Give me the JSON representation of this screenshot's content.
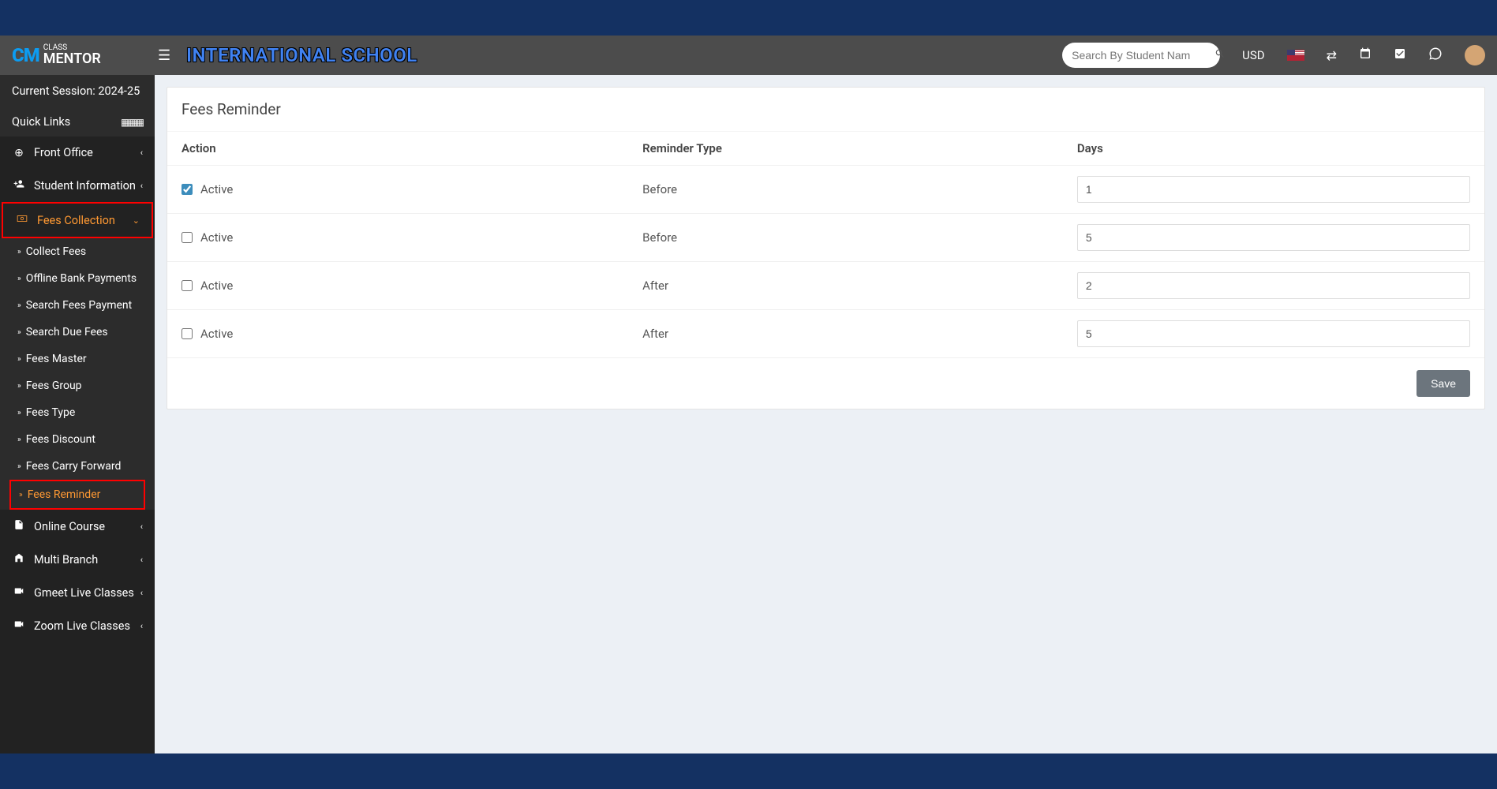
{
  "header": {
    "school_name": "INTERNATIONAL SCHOOL",
    "search_placeholder": "Search By Student Nam",
    "currency": "USD"
  },
  "sidebar": {
    "session_label": "Current Session: 2024-25",
    "quick_links_label": "Quick Links",
    "menu": [
      {
        "label": "Front Office"
      },
      {
        "label": "Student Information"
      },
      {
        "label": "Fees Collection"
      },
      {
        "label": "Online Course"
      },
      {
        "label": "Multi Branch"
      },
      {
        "label": "Gmeet Live Classes"
      },
      {
        "label": "Zoom Live Classes"
      }
    ],
    "fees_submenu": [
      {
        "label": "Collect Fees"
      },
      {
        "label": "Offline Bank Payments"
      },
      {
        "label": "Search Fees Payment"
      },
      {
        "label": "Search Due Fees"
      },
      {
        "label": "Fees Master"
      },
      {
        "label": "Fees Group"
      },
      {
        "label": "Fees Type"
      },
      {
        "label": "Fees Discount"
      },
      {
        "label": "Fees Carry Forward"
      },
      {
        "label": "Fees Reminder"
      }
    ]
  },
  "main": {
    "title": "Fees Reminder",
    "columns": {
      "action": "Action",
      "type": "Reminder Type",
      "days": "Days"
    },
    "active_label": "Active",
    "rows": [
      {
        "checked": true,
        "type": "Before",
        "days": "1"
      },
      {
        "checked": false,
        "type": "Before",
        "days": "5"
      },
      {
        "checked": false,
        "type": "After",
        "days": "2"
      },
      {
        "checked": false,
        "type": "After",
        "days": "5"
      }
    ],
    "save_button": "Save"
  }
}
